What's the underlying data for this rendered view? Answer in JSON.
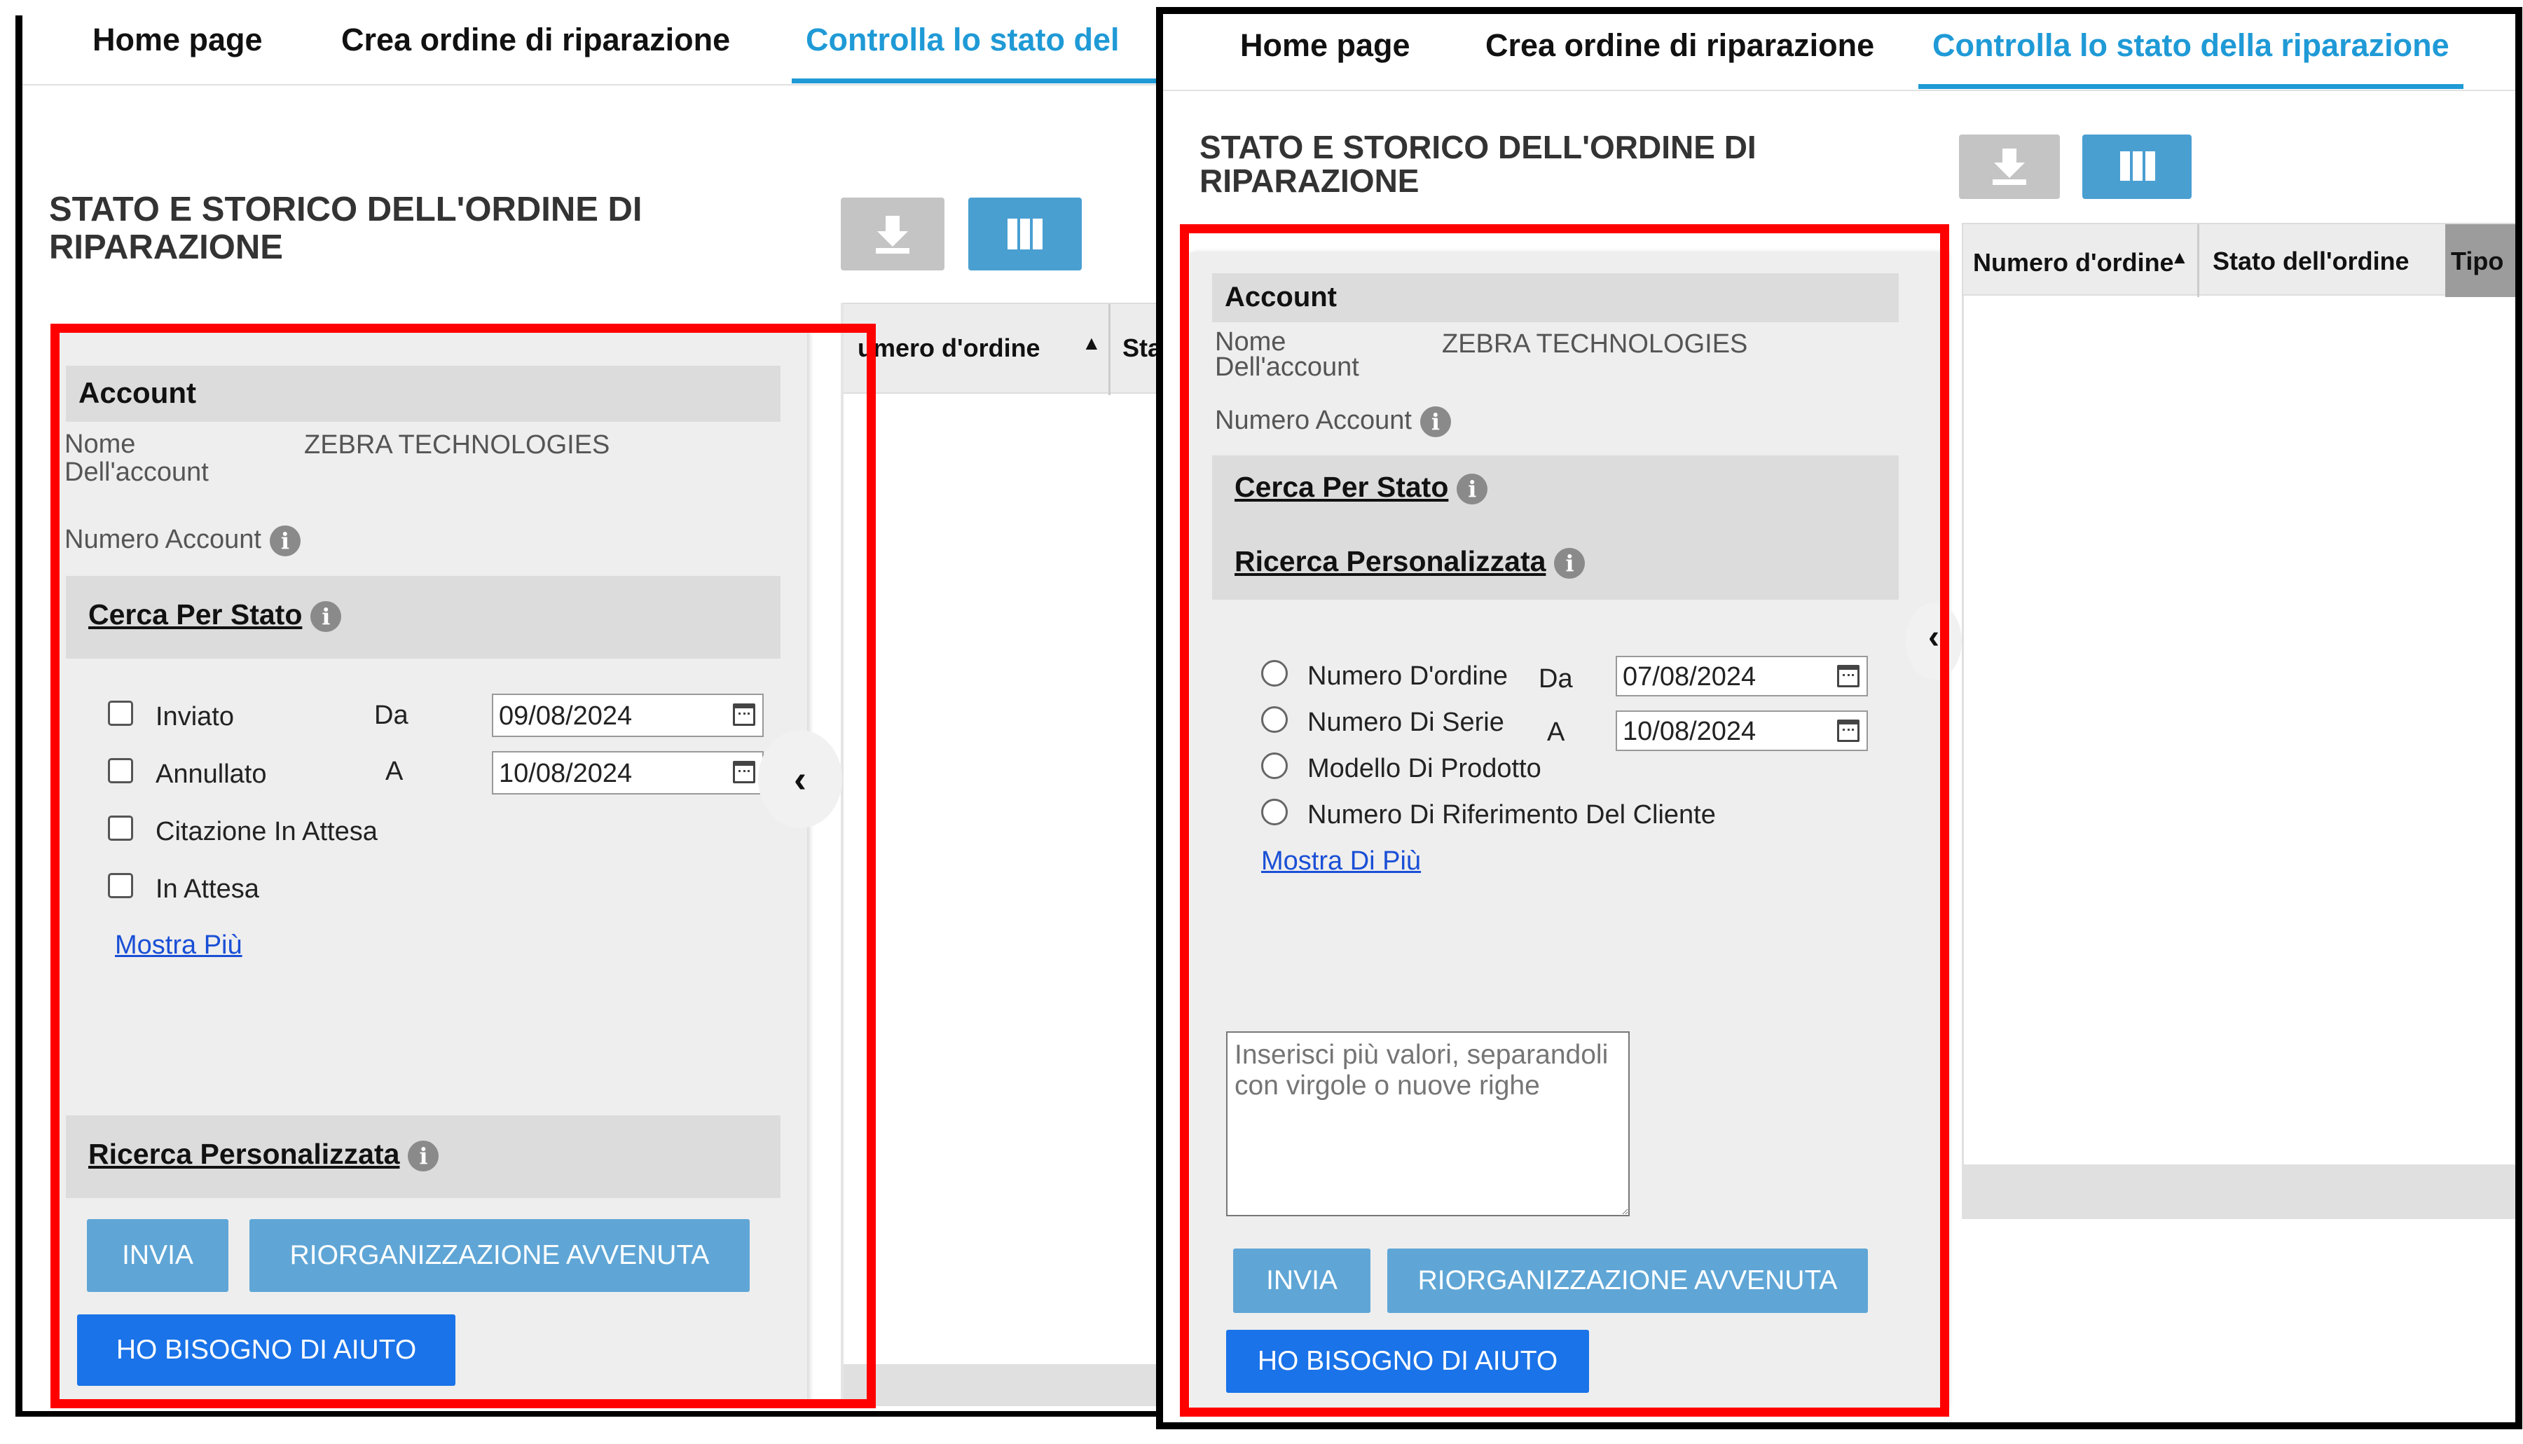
{
  "left": {
    "tabs": [
      "Home page",
      "Crea ordine di riparazione",
      "Controlla lo stato del"
    ],
    "title_line1": "STATO E STORICO DELL'ORDINE DI",
    "title_line2": "RIPARAZIONE",
    "account": {
      "header": "Account",
      "name_label_1": "Nome",
      "name_label_2": "Dell'account",
      "name_value": "ZEBRA TECHNOLOGIES",
      "number_label": "Numero Account"
    },
    "status_search": {
      "title": "Cerca Per Stato",
      "options": [
        "Inviato",
        "Annullato",
        "Citazione In Attesa",
        "In Attesa"
      ],
      "from_label": "Da",
      "to_label": "A",
      "from_date": "09/08/2024",
      "to_date": "10/08/2024",
      "show_more": "Mostra Più"
    },
    "custom_search": {
      "title": "Ricerca Personalizzata"
    },
    "buttons": {
      "submit": "INVIA",
      "reset": "RIORGANIZZAZIONE AVVENUTA",
      "help": "HO BISOGNO DI AIUTO"
    },
    "grid_columns": [
      "umero d'ordine",
      "Stat"
    ]
  },
  "right": {
    "tabs": [
      "Home page",
      "Crea ordine di riparazione",
      "Controlla lo stato della riparazione"
    ],
    "title_line1": "STATO E STORICO DELL'ORDINE DI",
    "title_line2": "RIPARAZIONE",
    "account": {
      "header": "Account",
      "name_label_1": "Nome",
      "name_label_2": "Dell'account",
      "name_value": "ZEBRA TECHNOLOGIES",
      "number_label": "Numero Account"
    },
    "status_search": {
      "title": "Cerca Per Stato"
    },
    "custom_search": {
      "title": "Ricerca Personalizzata",
      "options": [
        "Numero D'ordine",
        "Numero Di Serie",
        "Modello Di Prodotto",
        "Numero Di Riferimento Del Cliente"
      ],
      "from_label": "Da",
      "to_label": "A",
      "from_date": "07/08/2024",
      "to_date": "10/08/2024",
      "show_more": "Mostra Di Più",
      "textarea_placeholder": "Inserisci più valori, separandoli con virgole o nuove righe"
    },
    "buttons": {
      "submit": "INVIA",
      "reset": "RIORGANIZZAZIONE AVVENUTA",
      "help": "HO BISOGNO DI AIUTO"
    },
    "grid_columns": [
      "Numero d'ordine",
      "Stato dell'ordine",
      "Tipo"
    ]
  },
  "colors": {
    "accent": "#1f9ad6",
    "highlight": "#ff0000",
    "primary_button": "#5fa6d6",
    "help_button": "#1a73e8"
  }
}
